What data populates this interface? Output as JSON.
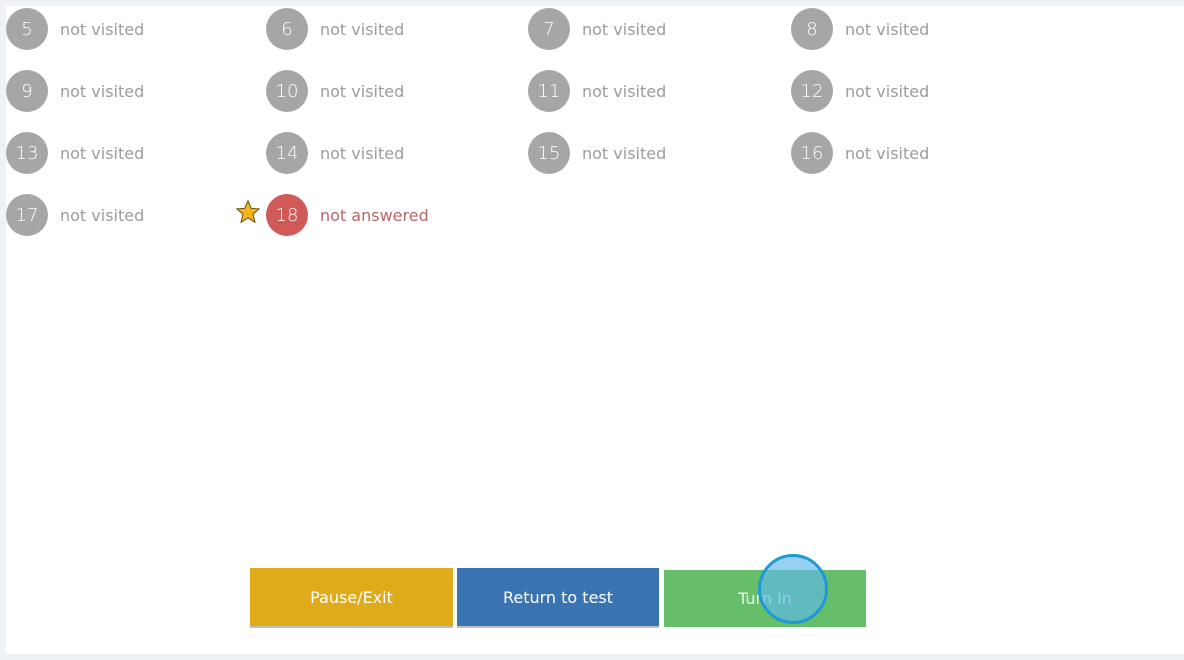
{
  "questions": [
    {
      "number": "5",
      "status": "not visited"
    },
    {
      "number": "6",
      "status": "not visited"
    },
    {
      "number": "7",
      "status": "not visited"
    },
    {
      "number": "8",
      "status": "not visited"
    },
    {
      "number": "9",
      "status": "not visited"
    },
    {
      "number": "10",
      "status": "not visited"
    },
    {
      "number": "11",
      "status": "not visited"
    },
    {
      "number": "12",
      "status": "not visited"
    },
    {
      "number": "13",
      "status": "not visited"
    },
    {
      "number": "14",
      "status": "not visited"
    },
    {
      "number": "15",
      "status": "not visited"
    },
    {
      "number": "16",
      "status": "not visited"
    },
    {
      "number": "17",
      "status": "not visited"
    },
    {
      "number": "18",
      "status": "not answered",
      "flagged": true
    }
  ],
  "buttons": {
    "pause_exit": "Pause/Exit",
    "return_to_test": "Return to test",
    "turn_in": "Turn In"
  },
  "colors": {
    "not_visited": "#a6a6a6",
    "not_answered": "#cf5a58",
    "flag_star": "#f2b51f",
    "pause": "#dfab1b",
    "return": "#3a73b1",
    "turn_in": "#66bd6a"
  }
}
